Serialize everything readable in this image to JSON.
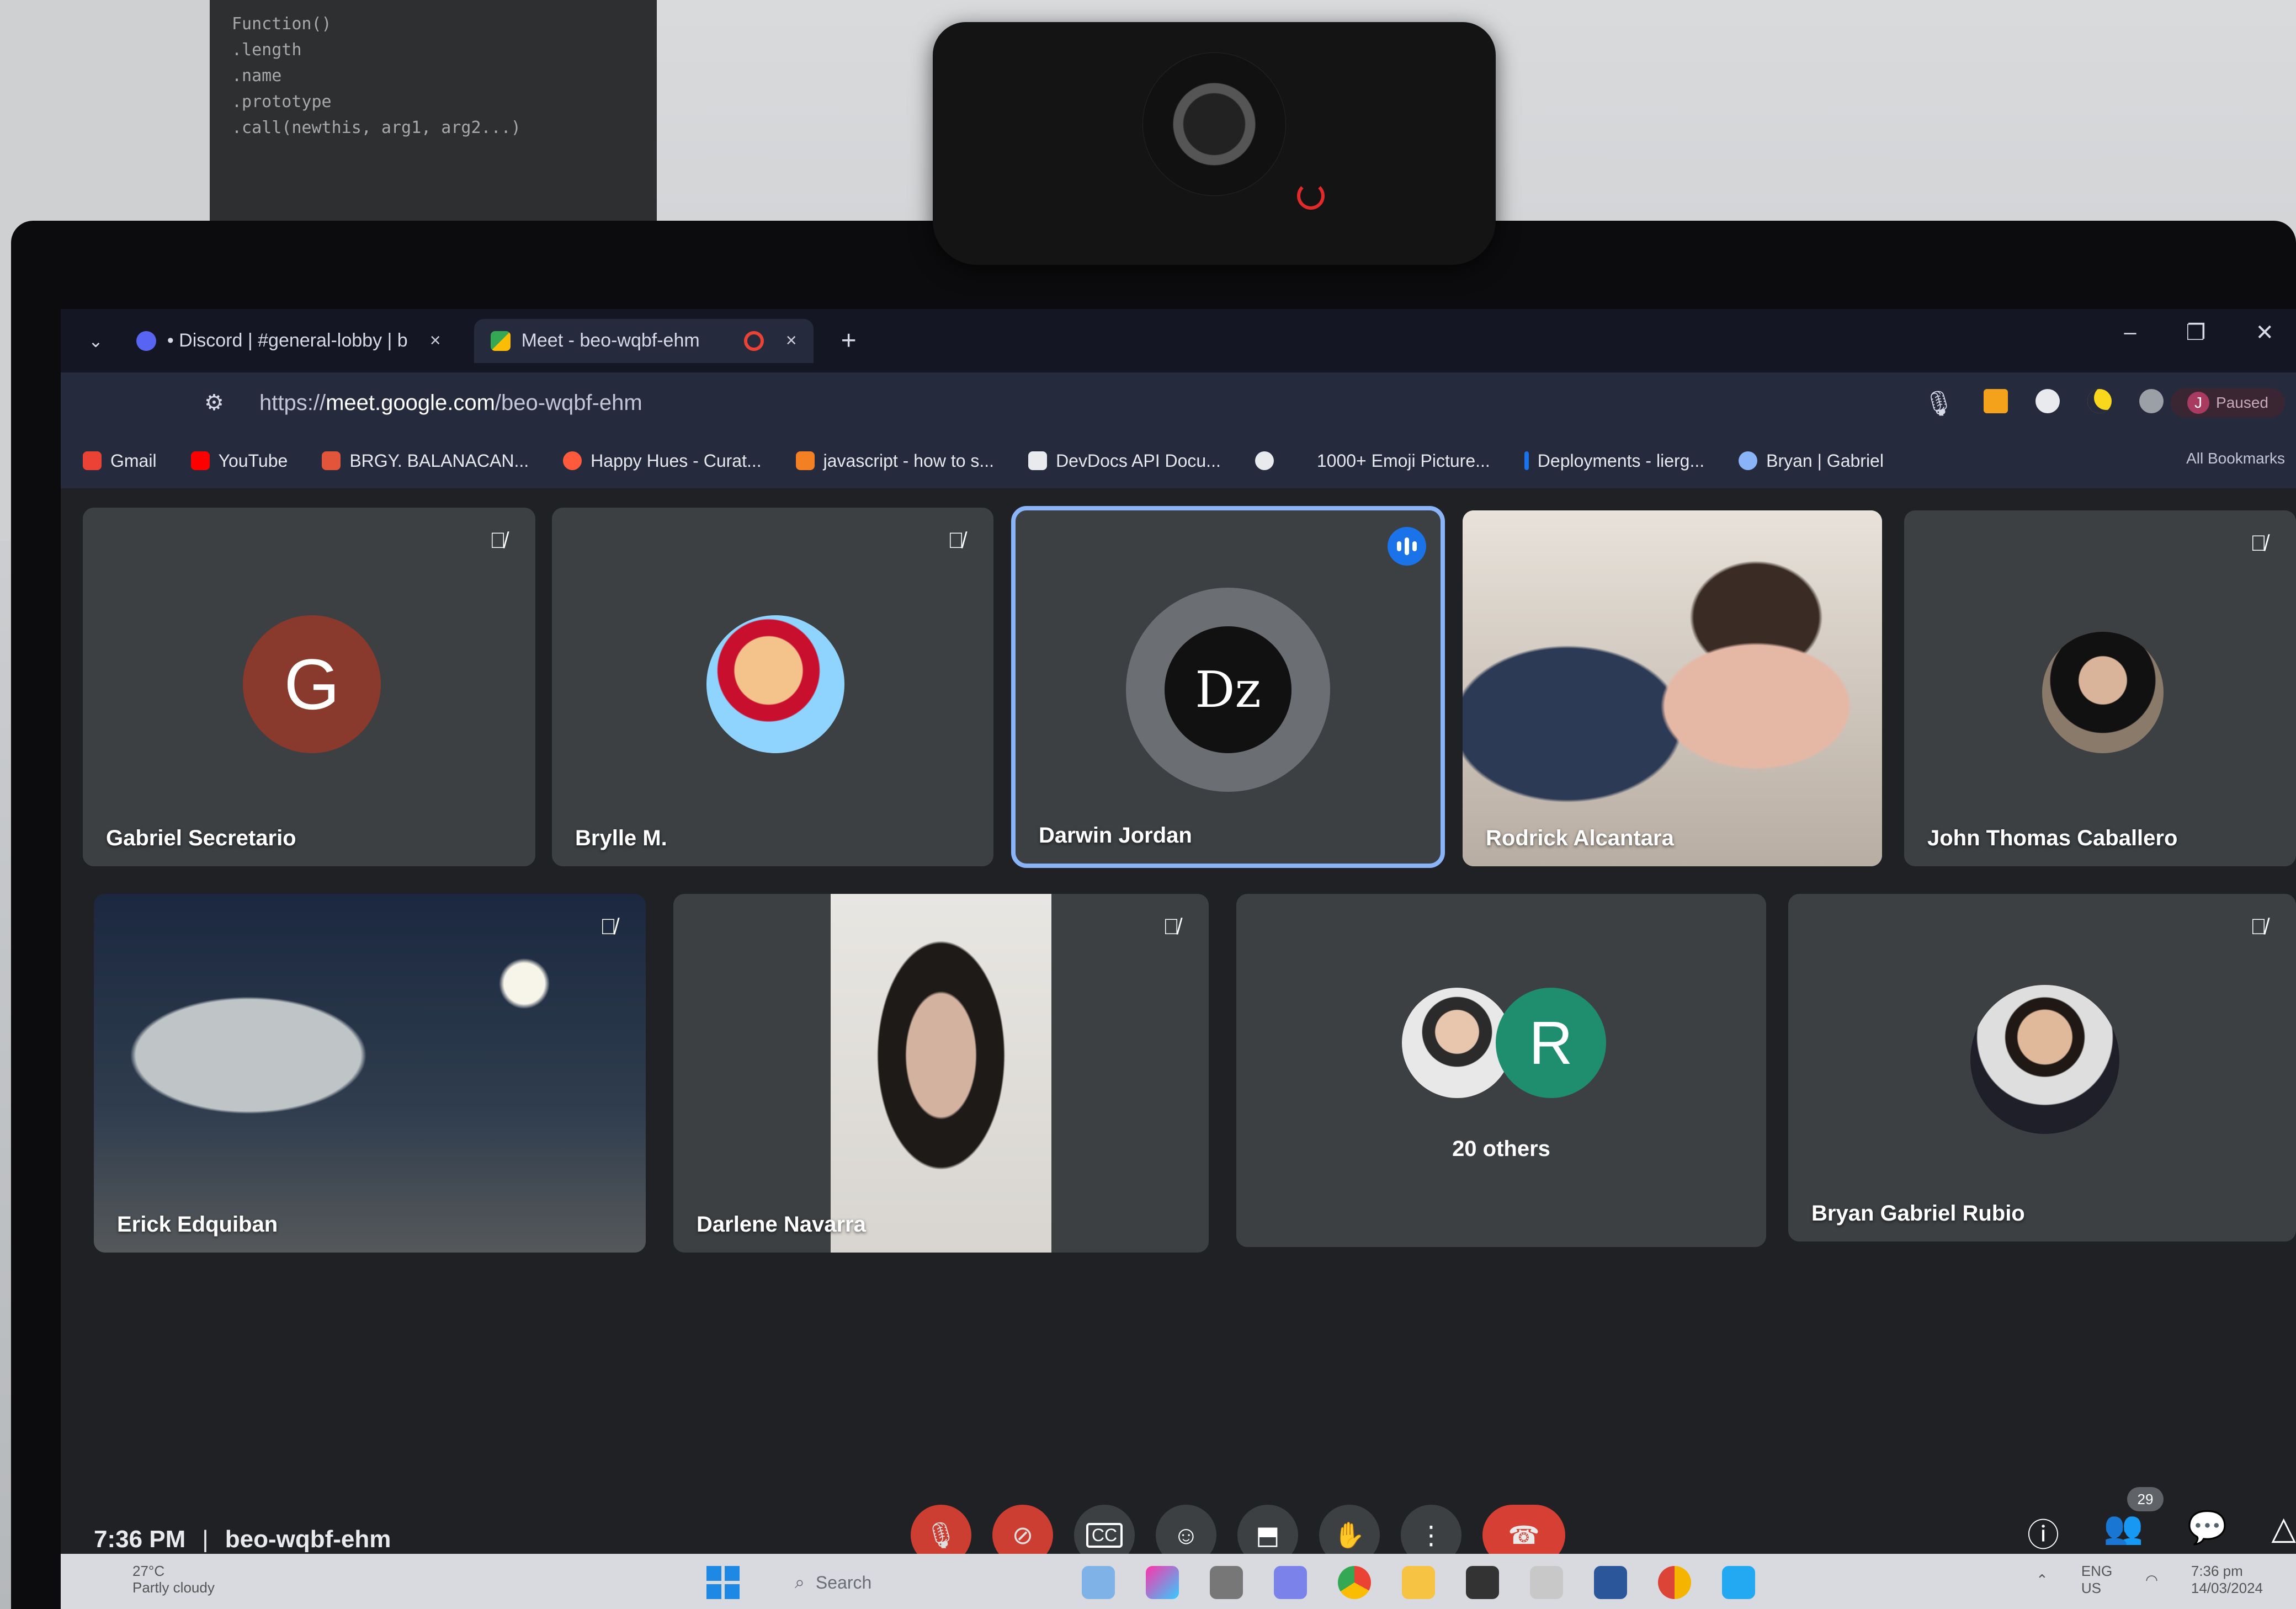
{
  "browser": {
    "tabs": [
      {
        "label": "• Discord | #general-lobby | b",
        "close": "×"
      },
      {
        "label": "Meet - beo-wqbf-ehm",
        "close": "×"
      }
    ],
    "new_tab": "+",
    "url_prefix": "https://",
    "url_domain": "meet.google.com",
    "url_path": "/beo-wqbf-ehm",
    "profile_label": "Paused",
    "profile_initial": "J",
    "all_bookmarks": "All Bookmarks",
    "bookmarks": [
      "Gmail",
      "YouTube",
      "BRGY. BALANACAN...",
      "Happy Hues - Curat...",
      "javascript - how to s...",
      "DevDocs API Docu...",
      "",
      "1000+ Emoji Picture...",
      "Deployments - lierg...",
      "Bryan | Gabriel"
    ]
  },
  "meet": {
    "participants": [
      {
        "name": "Gabriel Secretario",
        "initial": "G",
        "avatar_color": "#8a3a2c",
        "muted": true
      },
      {
        "name": "Brylle M.",
        "muted": true
      },
      {
        "name": "Darwin Jordan",
        "initial": "Dz",
        "muted": false,
        "speaking": true
      },
      {
        "name": "Rodrick Alcantara",
        "muted": false
      },
      {
        "name": "John Thomas Caballero",
        "muted": true
      },
      {
        "name": "Erick Edquiban",
        "muted": true
      },
      {
        "name": "Darlene Navarra",
        "muted": true
      },
      {
        "name": "Bryan Gabriel Rubio",
        "muted": true
      }
    ],
    "others_initial": "R",
    "others_label": "20 others",
    "others_color": "#1e8e6e",
    "time": "7:36 PM",
    "separator": "|",
    "meeting_code": "beo-wqbf-ehm",
    "people_count": "29"
  },
  "taskbar": {
    "weather_temp": "27°C",
    "weather_desc": "Partly cloudy",
    "search_placeholder": "Search",
    "lang": "ENG",
    "lang_region": "US",
    "clock_time": "7:36 pm",
    "clock_date": "14/03/2024"
  },
  "background": {
    "cheatsheet": [
      "Function()",
      ".length",
      ".name",
      ".prototype",
      ".call(newthis, arg1, arg2...)"
    ]
  }
}
